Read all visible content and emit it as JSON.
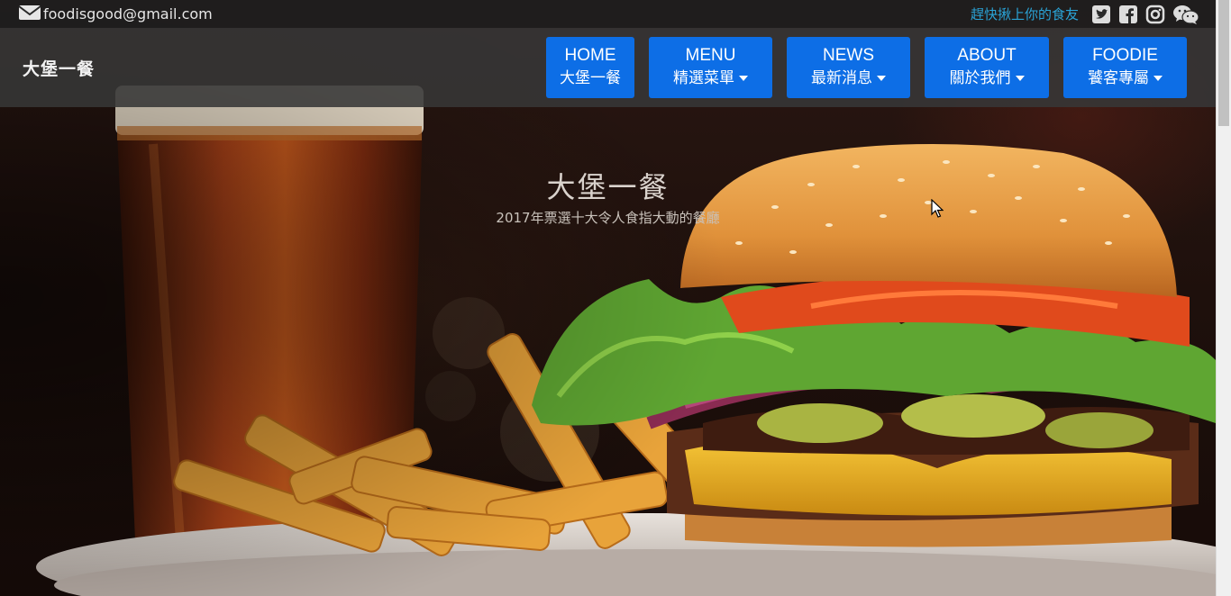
{
  "topbar": {
    "email": "foodisgood@gmail.com",
    "tagline": "趕快揪上你的食友",
    "social_icons": [
      "twitter-icon",
      "facebook-icon",
      "instagram-icon",
      "wechat-icon"
    ]
  },
  "navbar": {
    "brand": "大堡一餐",
    "items": [
      {
        "en": "HOME",
        "zh": "大堡一餐",
        "dropdown": false
      },
      {
        "en": "MENU",
        "zh": "精選菜單",
        "dropdown": true
      },
      {
        "en": "NEWS",
        "zh": "最新消息",
        "dropdown": true
      },
      {
        "en": "ABOUT",
        "zh": "關於我們",
        "dropdown": true
      },
      {
        "en": "FOODIE",
        "zh": "饕客專屬",
        "dropdown": true
      }
    ]
  },
  "hero": {
    "title": "大堡一餐",
    "subtitle": "2017年票選十大令人食指大動的餐廳",
    "image": "burger-beer-fries-photo"
  },
  "colors": {
    "nav_button": "#0d6ee6",
    "tagline": "#2aa3d6",
    "topbar_bg": "#1e1e1e",
    "navbar_bg": "#373737"
  }
}
